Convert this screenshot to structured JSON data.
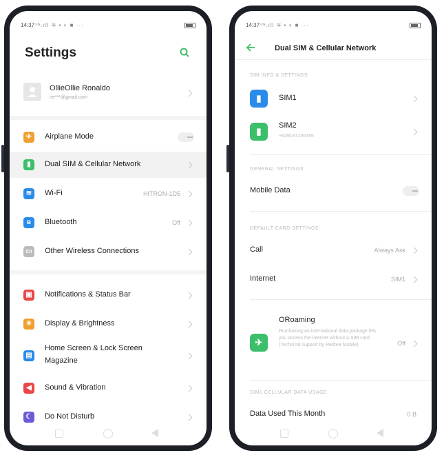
{
  "left": {
    "status": {
      "time": "14:37",
      "signal": "⁴ᴳ.ıll ≋ ▪ ◐ ■ ···"
    },
    "title": "Settings",
    "account": {
      "name": "OllieOllie Ronaldo",
      "email": "ne***@gmail.com"
    },
    "items": [
      {
        "label": "Airplane Mode",
        "value": "",
        "color": "#f0a030",
        "icon": "✈"
      },
      {
        "label": "Dual SIM & Cellular Network",
        "value": "",
        "color": "#3cbf6a",
        "icon": "▮"
      },
      {
        "label": "Wi-Fi",
        "value": "HITRON-1D5",
        "color": "#2a8bea",
        "icon": "≋"
      },
      {
        "label": "Bluetooth",
        "value": "Off",
        "color": "#2a8bea",
        "icon": "ʙ"
      },
      {
        "label": "Other Wireless Connections",
        "value": "",
        "color": "#bbbbbb",
        "icon": "▭"
      },
      {
        "label": "Notifications & Status Bar",
        "value": "",
        "color": "#e84848",
        "icon": "▣"
      },
      {
        "label": "Display & Brightness",
        "value": "",
        "color": "#f0a030",
        "icon": "☀"
      },
      {
        "label": "Home Screen & Lock Screen",
        "label2": "Magazine",
        "value": "",
        "color": "#2a8bea",
        "icon": "▤"
      },
      {
        "label": "Sound & Vibration",
        "value": "",
        "color": "#e84848",
        "icon": "◀"
      },
      {
        "label": "Do Not Disturb",
        "value": "",
        "color": "#6b5bd6",
        "icon": "☾"
      }
    ]
  },
  "right": {
    "status": {
      "time": "14:37",
      "signal": "⁴ᴳ.ıll ≋ ▪ ◐ ■ ···"
    },
    "title": "Dual SIM & Cellular Network",
    "section1": "SIM INFO & SETTINGS",
    "sim1": {
      "label": "SIM1"
    },
    "sim2": {
      "label": "SIM2",
      "number": "+639187256785"
    },
    "section2": "GENERAL SETTINGS",
    "mobile_data": "Mobile Data",
    "section3": "DEFAULT CARD SETTINGS",
    "call": {
      "label": "Call",
      "value": "Always Ask"
    },
    "internet": {
      "label": "Internet",
      "value": "SIM1"
    },
    "oroaming": {
      "label": "ORoaming",
      "desc": "Purchasing an international data package lets you access the internet without a SIM card. (Technical support by Redtea Mobile)",
      "value": "Off"
    },
    "section4": "SIM1 CELLULAR DATA USAGE",
    "data_used": {
      "label": "Data Used This Month",
      "value": "0 B"
    }
  },
  "colors": {
    "accent_green": "#3cbf6a",
    "sim_blue": "#2a8bea"
  }
}
